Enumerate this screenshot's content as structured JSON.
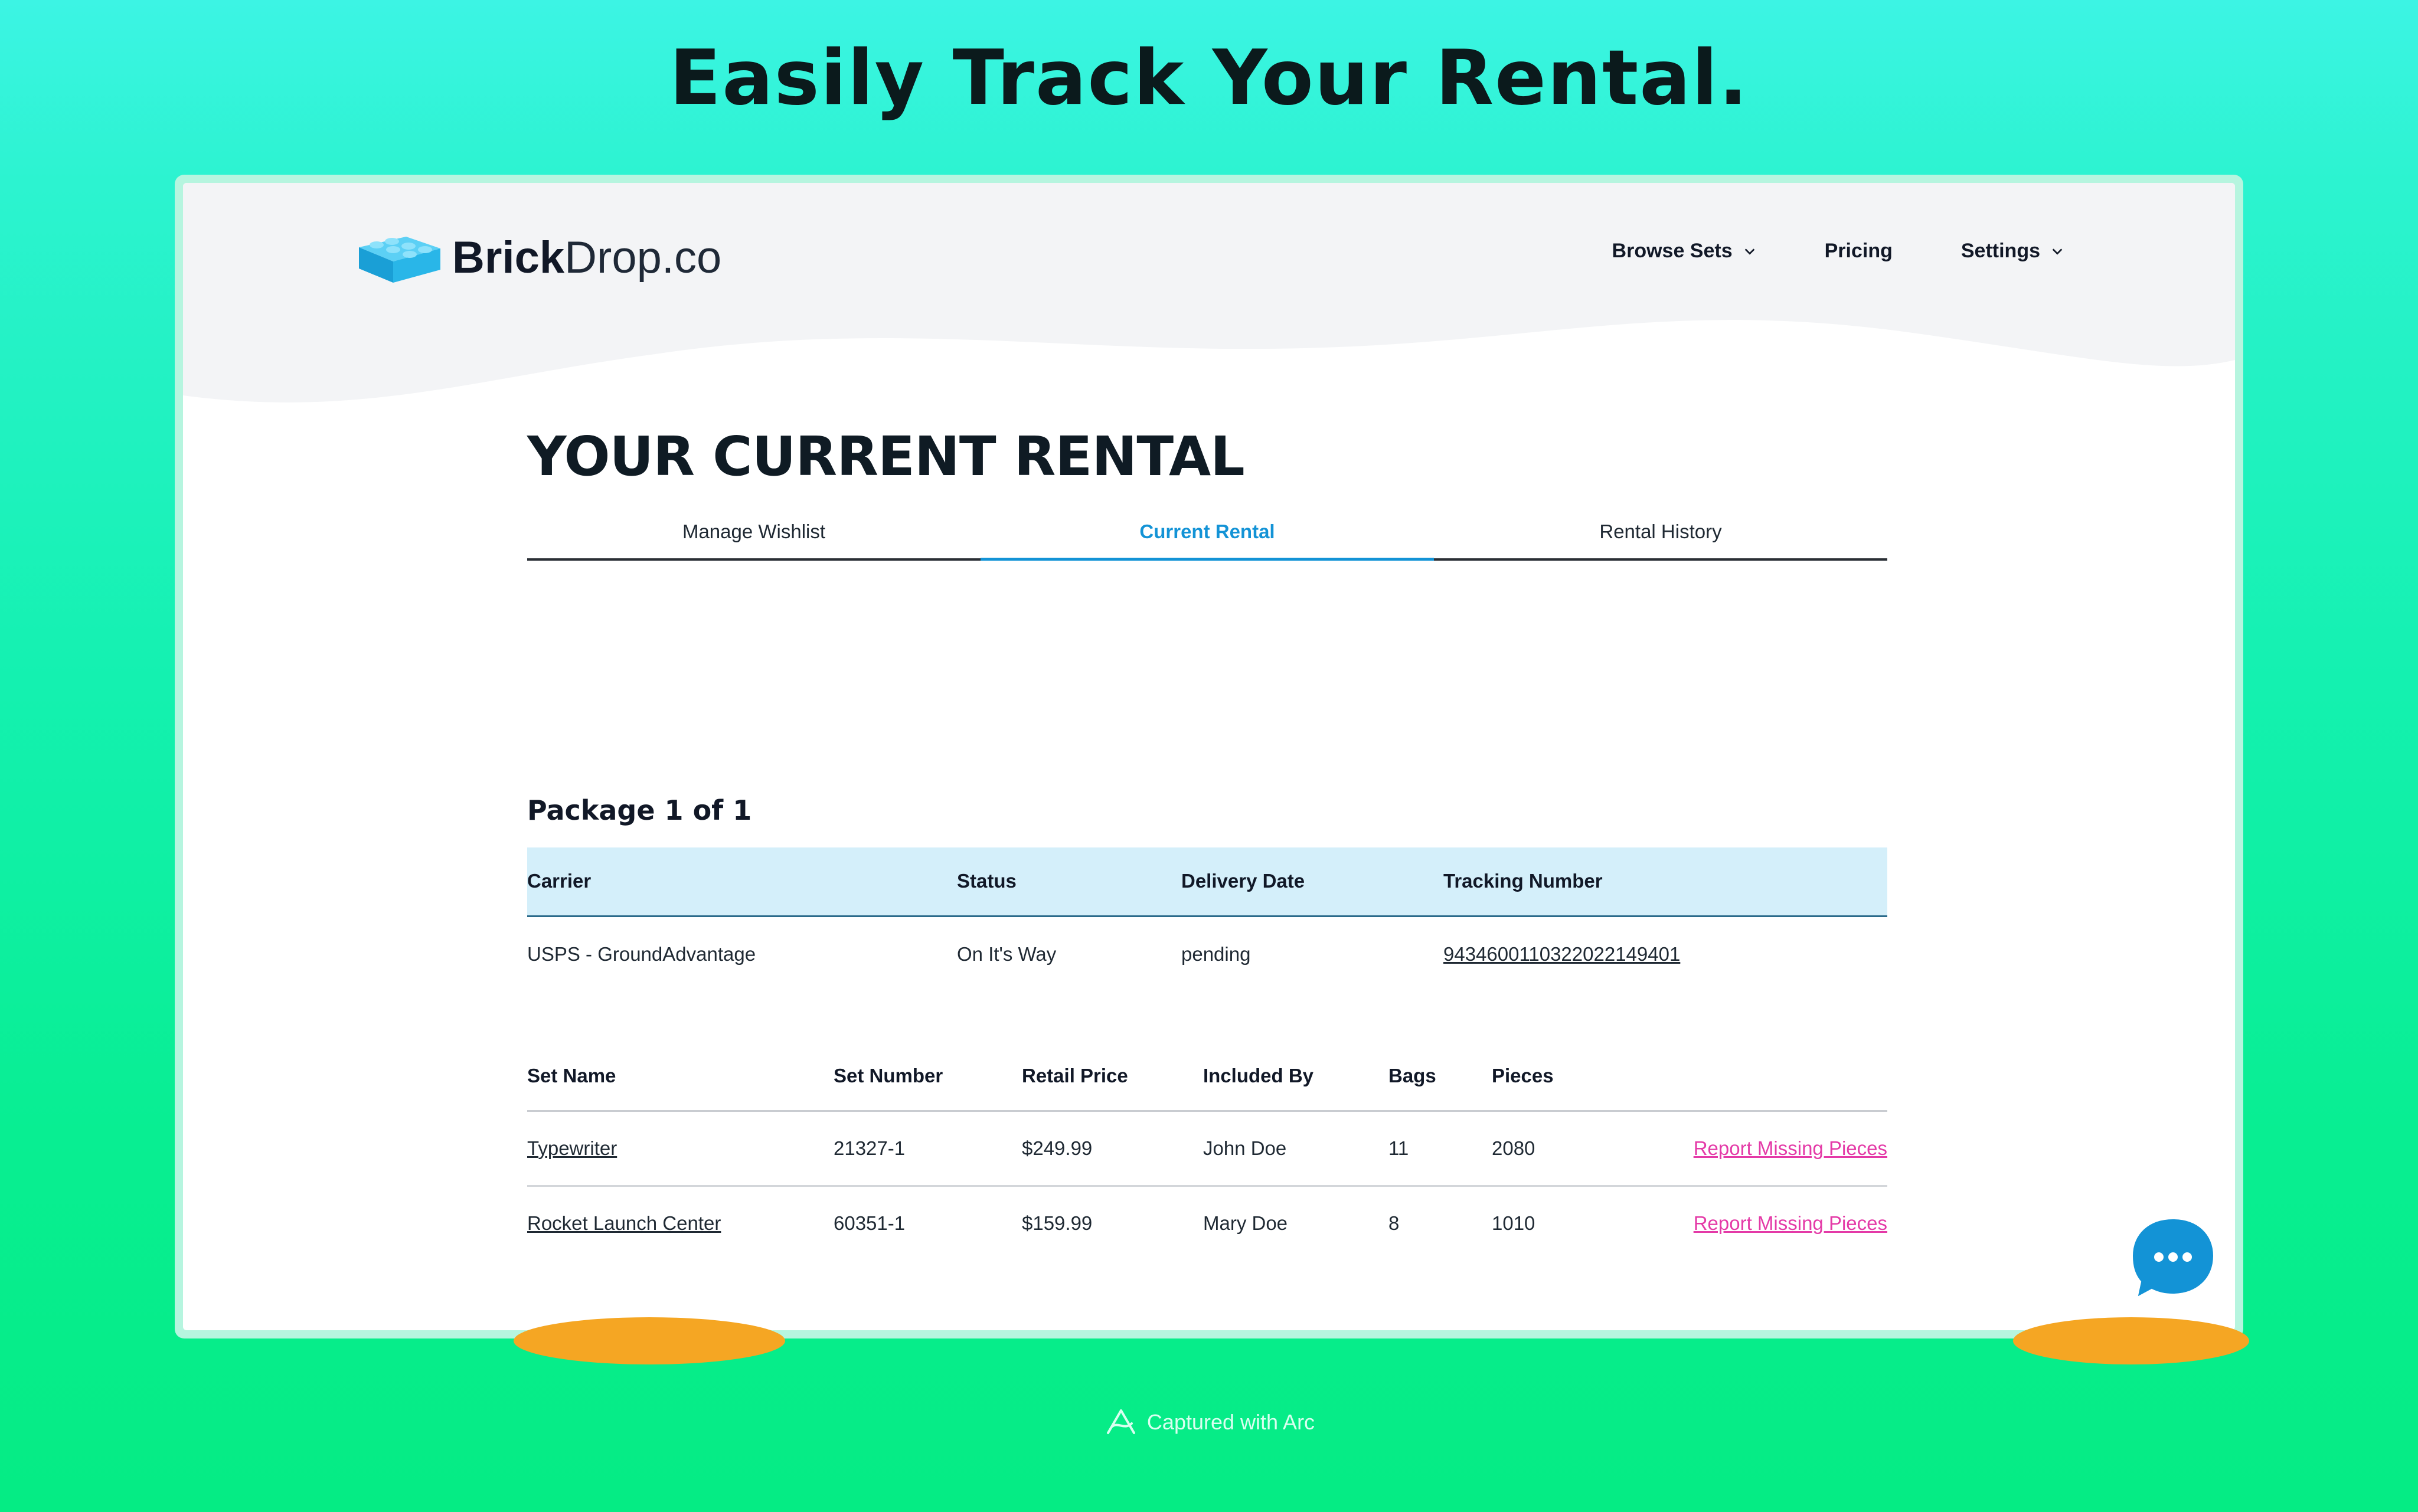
{
  "headline": "Easily Track Your Rental.",
  "brand": {
    "brick": "Brick",
    "drop": "Drop.co"
  },
  "nav": {
    "browse_sets": "Browse Sets",
    "pricing": "Pricing",
    "settings": "Settings"
  },
  "page_title": "YOUR CURRENT RENTAL",
  "tabs": [
    "Manage Wishlist",
    "Current Rental",
    "Rental History"
  ],
  "active_tab": "Current Rental",
  "package_title": "Package 1 of 1",
  "shipment": {
    "headers": [
      "Carrier",
      "Status",
      "Delivery Date",
      "Tracking Number"
    ],
    "row": {
      "carrier": "USPS - GroundAdvantage",
      "status": "On It's Way",
      "delivery_date": "pending",
      "tracking": "9434600110322022149401"
    }
  },
  "sets": {
    "headers": [
      "Set Name",
      "Set Number",
      "Retail Price",
      "Included By",
      "Bags",
      "Pieces"
    ],
    "rows": [
      {
        "name": "Typewriter",
        "number": "21327-1",
        "price": "$249.99",
        "included_by": "John Doe",
        "bags": "11",
        "pieces": "2080",
        "action": "Report Missing Pieces"
      },
      {
        "name": "Rocket Launch Center",
        "number": "60351-1",
        "price": "$159.99",
        "included_by": "Mary Doe",
        "bags": "8",
        "pieces": "1010",
        "action": "Report Missing Pieces"
      }
    ]
  },
  "footer": "Captured with Arc",
  "colors": {
    "accent": "#1393d6",
    "link_pink": "#e43aa7",
    "logo_orange": "#f5a623",
    "logo_blue": "#29b6e8"
  }
}
